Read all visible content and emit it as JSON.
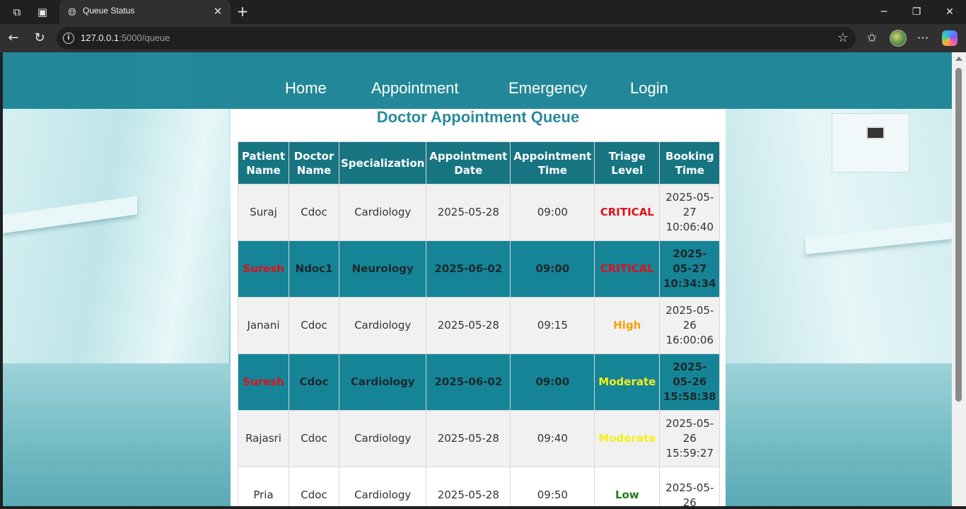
{
  "browser": {
    "tab_title": "Queue Status",
    "url_host": "127.0.0.1",
    "url_rest": ":5000/queue"
  },
  "nav": {
    "links": [
      "Home",
      "Appointment",
      "Emergency",
      "Login"
    ]
  },
  "page": {
    "heading": "Doctor Appointment Queue"
  },
  "table": {
    "headers": [
      [
        "Patient",
        "Name"
      ],
      [
        "Doctor",
        "Name"
      ],
      [
        "Specialization"
      ],
      [
        "Appointment",
        "Date"
      ],
      [
        "Appointment",
        "Time"
      ],
      [
        "Triage",
        "Level"
      ],
      [
        "Booking",
        "Time"
      ]
    ],
    "rows": [
      {
        "patient": "Suraj",
        "doctor": "Cdoc",
        "spec": "Cardiology",
        "date": "2025-05-28",
        "time": "09:00",
        "triage": "CRITICAL",
        "booking": [
          "2025-05-",
          "27",
          "10:06:40"
        ],
        "highlight": false
      },
      {
        "patient": "Suresh",
        "doctor": "Ndoc1",
        "spec": "Neurology",
        "date": "2025-06-02",
        "time": "09:00",
        "triage": "CRITICAL",
        "booking": [
          "2025-",
          "05-27",
          "10:34:34"
        ],
        "highlight": true
      },
      {
        "patient": "Janani",
        "doctor": "Cdoc",
        "spec": "Cardiology",
        "date": "2025-05-28",
        "time": "09:15",
        "triage": "High",
        "booking": [
          "2025-05-",
          "26",
          "16:00:06"
        ],
        "highlight": false
      },
      {
        "patient": "Suresh",
        "doctor": "Cdoc",
        "spec": "Cardiology",
        "date": "2025-06-02",
        "time": "09:00",
        "triage": "Moderate",
        "booking": [
          "2025-",
          "05-26",
          "15:58:38"
        ],
        "highlight": true
      },
      {
        "patient": "Rajasri",
        "doctor": "Cdoc",
        "spec": "Cardiology",
        "date": "2025-05-28",
        "time": "09:40",
        "triage": "Moderate",
        "booking": [
          "2025-05-",
          "26",
          "15:59:27"
        ],
        "highlight": false
      },
      {
        "patient": "Pria",
        "doctor": "Cdoc",
        "spec": "Cardiology",
        "date": "2025-05-28",
        "time": "09:50",
        "triage": "Low",
        "booking": [
          "2025-05-",
          "26",
          ""
        ],
        "highlight": false,
        "white": true
      }
    ]
  },
  "colors": {
    "navbar": "#168092",
    "header_cell": "#177582",
    "highlight_row": "#168497",
    "heading": "#2a8a9c",
    "critical": "#e0101a",
    "high": "#f5a100",
    "moderate": "#f5ef1a",
    "low": "#1b7d1b"
  },
  "icons": [
    "workspaces-icon",
    "vertical-tabs-icon",
    "globe-icon",
    "close-icon",
    "plus-icon",
    "minimize-icon",
    "restore-icon",
    "window-close-icon",
    "back-icon",
    "refresh-icon",
    "site-info-icon",
    "favorite-star-icon",
    "favorites-icon",
    "profile-avatar-icon",
    "more-icon",
    "copilot-icon"
  ]
}
